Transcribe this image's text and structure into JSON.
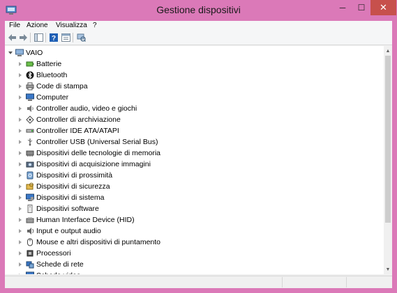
{
  "window": {
    "title": "Gestione dispositivi",
    "min_glyph": "─",
    "max_glyph": "☐",
    "close_glyph": "✕"
  },
  "menu": [
    "File",
    "Azione",
    "Visualizza",
    "?"
  ],
  "tree": {
    "root": "VAIO",
    "items": [
      {
        "label": "Batterie",
        "icon": "battery-icon"
      },
      {
        "label": "Bluetooth",
        "icon": "bluetooth-icon"
      },
      {
        "label": "Code di stampa",
        "icon": "printer-icon"
      },
      {
        "label": "Computer",
        "icon": "computer-icon"
      },
      {
        "label": "Controller audio, video e giochi",
        "icon": "speaker-icon"
      },
      {
        "label": "Controller di archiviazione",
        "icon": "storage-controller-icon"
      },
      {
        "label": "Controller IDE ATA/ATAPI",
        "icon": "ide-controller-icon"
      },
      {
        "label": "Controller USB (Universal Serial Bus)",
        "icon": "usb-icon"
      },
      {
        "label": "Dispositivi delle tecnologie di memoria",
        "icon": "memory-icon"
      },
      {
        "label": "Dispositivi di acquisizione immagini",
        "icon": "camera-icon"
      },
      {
        "label": "Dispositivi di prossimità",
        "icon": "proximity-icon"
      },
      {
        "label": "Dispositivi di sicurezza",
        "icon": "security-icon"
      },
      {
        "label": "Dispositivi di sistema",
        "icon": "system-device-icon"
      },
      {
        "label": "Dispositivi software",
        "icon": "software-device-icon"
      },
      {
        "label": "Human Interface Device (HID)",
        "icon": "hid-icon"
      },
      {
        "label": "Input e output audio",
        "icon": "audio-io-icon"
      },
      {
        "label": "Mouse e altri dispositivi di puntamento",
        "icon": "mouse-icon"
      },
      {
        "label": "Processori",
        "icon": "processor-icon"
      },
      {
        "label": "Schede di rete",
        "icon": "network-adapter-icon"
      },
      {
        "label": "Schede video",
        "icon": "display-adapter-icon"
      }
    ]
  },
  "colors": {
    "frame": "#db79b8",
    "close": "#c7504c",
    "help": "#1e5fb5"
  }
}
